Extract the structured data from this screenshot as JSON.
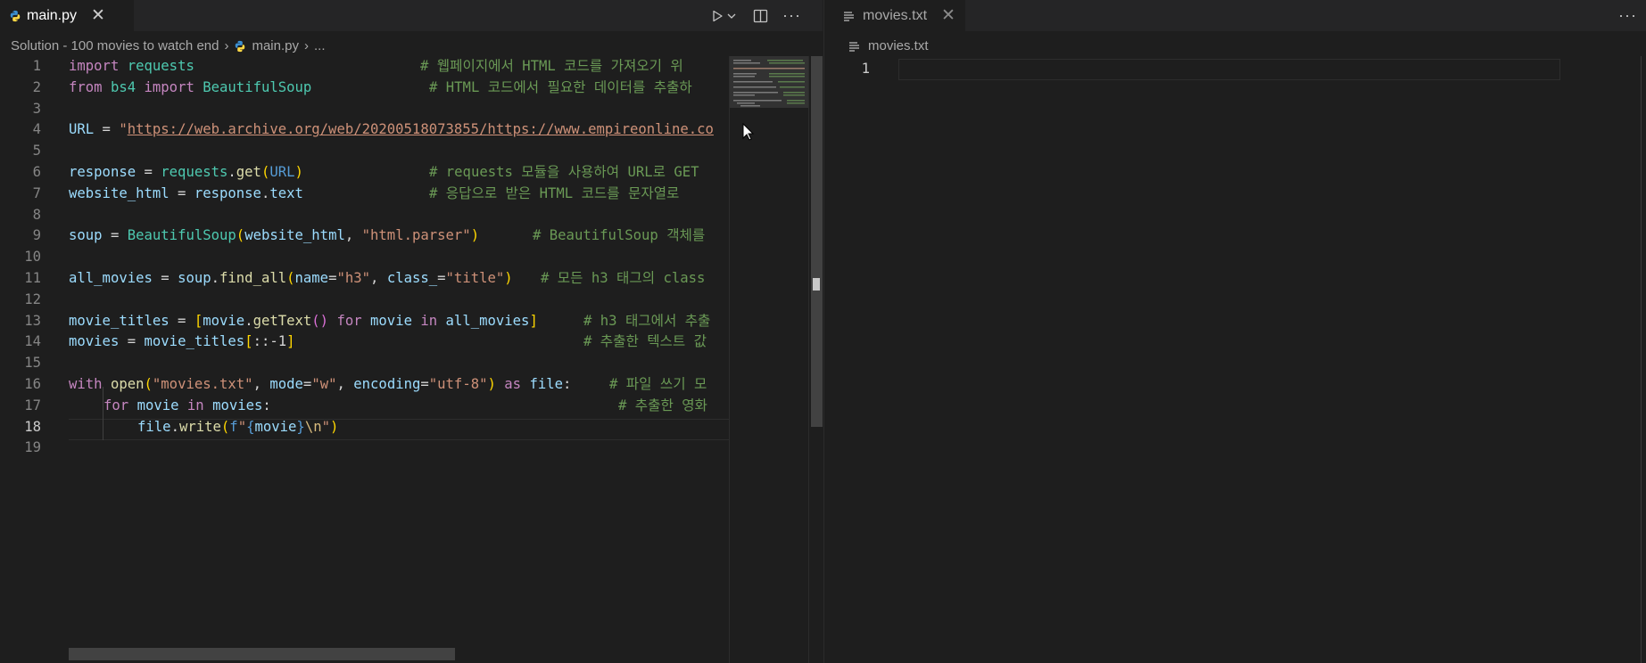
{
  "left_editor": {
    "tab": {
      "icon": "python-icon",
      "label": "main.py"
    },
    "breadcrumb": {
      "folder": "Solution - 100 movies to watch end",
      "file": "main.py",
      "more": "..."
    },
    "current_line": 18,
    "lines": [
      {
        "n": "1"
      },
      {
        "n": "2"
      },
      {
        "n": "3"
      },
      {
        "n": "4"
      },
      {
        "n": "5"
      },
      {
        "n": "6"
      },
      {
        "n": "7"
      },
      {
        "n": "8"
      },
      {
        "n": "9"
      },
      {
        "n": "10"
      },
      {
        "n": "11"
      },
      {
        "n": "12"
      },
      {
        "n": "13"
      },
      {
        "n": "14"
      },
      {
        "n": "15"
      },
      {
        "n": "16"
      },
      {
        "n": "17"
      },
      {
        "n": "18"
      },
      {
        "n": "19"
      }
    ],
    "code": {
      "l1": {
        "a": "import",
        "b": "requests",
        "c": "# 웹페이지에서 HTML 코드를 가져오기 위"
      },
      "l2": {
        "a": "from",
        "b": "bs4",
        "c": "import",
        "d": "BeautifulSoup",
        "e": "# HTML 코드에서 필요한 데이터를 추출하"
      },
      "l4": {
        "a": "URL",
        "b": " = ",
        "c": "\"",
        "d": "https://web.archive.org/web/20200518073855/https://www.empireonline.co"
      },
      "l6": {
        "a": "response",
        "b": " = ",
        "c": "requests",
        "d": ".",
        "e": "get",
        "f": "(",
        "g": "URL",
        "h": ")",
        "i": "# requests 모듈을 사용하여 URL로 GET"
      },
      "l7": {
        "a": "website_html",
        "b": " = ",
        "c": "response",
        "d": ".",
        "e": "text",
        "f": "# 응답으로 받은 HTML 코드를 문자열로"
      },
      "l9": {
        "a": "soup",
        "b": " = ",
        "c": "BeautifulSoup",
        "d": "(",
        "e": "website_html",
        "f": ", ",
        "g": "\"html.parser\"",
        "h": ")",
        "i": "# BeautifulSoup 객체를"
      },
      "l11": {
        "a": "all_movies",
        "b": " = ",
        "c": "soup",
        "d": ".",
        "e": "find_all",
        "f": "(",
        "g": "name",
        "h": "=",
        "i": "\"h3\"",
        "j": ", ",
        "k": "class_",
        "l": "=",
        "m": "\"title\"",
        "n": ")",
        "o": "# 모든 h3 태그의 class"
      },
      "l13": {
        "a": "movie_titles",
        "b": " = ",
        "c": "[",
        "d": "movie",
        "e": ".",
        "f": "getText",
        "g": "()",
        "h": " for ",
        "i": "movie",
        "j": " in ",
        "k": "all_movies",
        "l": "]",
        "m": "# h3 태그에서 추출"
      },
      "l14": {
        "a": "movies",
        "b": " = ",
        "c": "movie_titles",
        "d": "[",
        "e": "::-1",
        "f": "]",
        "g": "# 추출한 텍스트 값"
      },
      "l16": {
        "a": "with",
        "b": "open",
        "c": "(",
        "d": "\"movies.txt\"",
        "e": ", ",
        "f": "mode",
        "g": "=",
        "h": "\"w\"",
        "i": ", ",
        "j": "encoding",
        "k": "=",
        "l": "\"utf-8\"",
        "m": ")",
        "n": " as ",
        "o": "file",
        "p": ":",
        "q": "# 파일 쓰기 모"
      },
      "l17": {
        "a": "for",
        "b": "movie",
        "c": "in",
        "d": "movies",
        "e": ":",
        "f": "# 추출한 영화"
      },
      "l18": {
        "a": "file",
        "b": ".",
        "c": "write",
        "d": "(",
        "e": "f",
        "f": "\"",
        "g": "{",
        "h": "movie",
        "i": "}",
        "j": "\\n",
        "k": "\"",
        "l": ")"
      }
    },
    "actions": {
      "run": "run-icon",
      "dropdown": "chevron-down-icon",
      "split": "split-editor-icon",
      "more": "more-icon"
    }
  },
  "right_editor": {
    "tab": {
      "icon": "text-file-icon",
      "label": "movies.txt"
    },
    "breadcrumb": {
      "file": "movies.txt"
    },
    "lines": [
      {
        "n": "1"
      }
    ],
    "actions": {
      "more": "more-icon"
    }
  },
  "colors": {
    "background": "#1e1e1e",
    "tabbar": "#252526",
    "keyword": "#c586c0",
    "builtin_keyword": "#569cd6",
    "type": "#4ec9b0",
    "function": "#dcdcaa",
    "variable": "#9cdcfe",
    "string": "#ce9178",
    "comment": "#6a9955"
  }
}
